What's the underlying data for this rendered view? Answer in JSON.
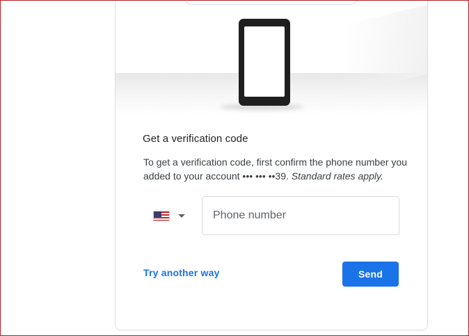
{
  "card": {
    "title": "Get a verification code",
    "description_main": "To get a verification code, first confirm the phone number you added to your account ••• ••• ••39. ",
    "description_note": "Standard rates apply."
  },
  "phone_form": {
    "country_flag": "us-flag-icon",
    "phone_placeholder": "Phone number",
    "phone_value": ""
  },
  "actions": {
    "try_another_label": "Try another way",
    "send_label": "Send"
  },
  "colors": {
    "accent": "#1a73e8",
    "border": "#dadce0",
    "frame": "#b11f24"
  }
}
